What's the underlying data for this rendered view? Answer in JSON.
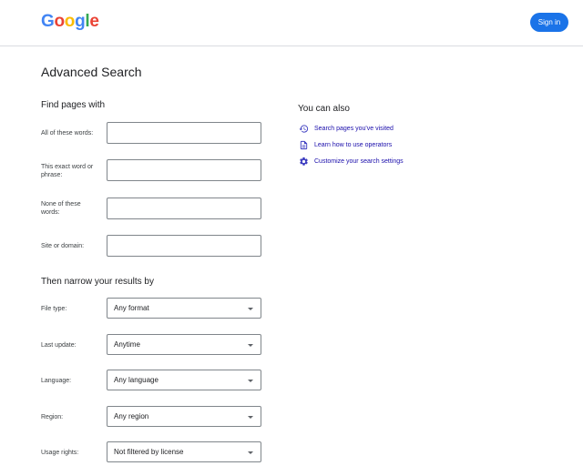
{
  "header": {
    "logo": {
      "letters": [
        "G",
        "o",
        "o",
        "g",
        "l",
        "e"
      ],
      "colors": [
        "#4285f4",
        "#ea4335",
        "#fbbc05",
        "#4285f4",
        "#34a853",
        "#ea4335"
      ]
    },
    "signin_label": "Sign in"
  },
  "page_title": "Advanced Search",
  "find_section": {
    "title": "Find pages with",
    "fields": [
      {
        "label": "All of these words:",
        "value": ""
      },
      {
        "label": "This exact word or phrase:",
        "value": ""
      },
      {
        "label": "None of these words:",
        "value": ""
      },
      {
        "label": "Site or domain:",
        "value": ""
      }
    ]
  },
  "narrow_section": {
    "title": "Then narrow your results by",
    "selects": [
      {
        "label": "File type:",
        "value": "Any format"
      },
      {
        "label": "Last update:",
        "value": "Anytime"
      },
      {
        "label": "Language:",
        "value": "Any language"
      },
      {
        "label": "Region:",
        "value": "Any region"
      },
      {
        "label": "Usage rights:",
        "value": "Not filtered by license"
      }
    ]
  },
  "also_section": {
    "title": "You can also",
    "links": [
      {
        "label": "Search pages you've visited",
        "icon": "history-icon"
      },
      {
        "label": "Learn how to use operators",
        "icon": "document-icon"
      },
      {
        "label": "Customize your search settings",
        "icon": "gear-icon"
      }
    ]
  },
  "colors": {
    "accent": "#1a73e8",
    "link": "#1a0dab",
    "icon": "#3c3cc0"
  }
}
